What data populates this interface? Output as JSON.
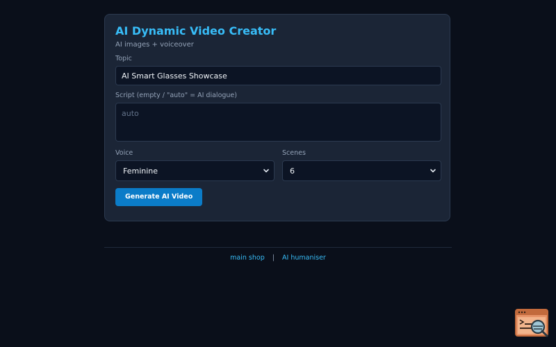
{
  "header": {
    "title": "AI Dynamic Video Creator",
    "subtitle": "AI images + voiceover"
  },
  "form": {
    "topic_label": "Topic",
    "topic_value": "AI Smart Glasses Showcase",
    "script_label": "Script (empty / \"auto\" = AI dialogue)",
    "script_placeholder": "auto",
    "voice_label": "Voice",
    "voice_value": "Feminine",
    "scenes_label": "Scenes",
    "scenes_value": "6",
    "generate_label": "Generate AI Video"
  },
  "footer": {
    "link1": "main shop",
    "separator": "|",
    "link2": "AI humaniser"
  },
  "colors": {
    "accent": "#38bdf8",
    "button": "#0b7cc8",
    "background": "#0a0f1a",
    "card": "#1b2536"
  },
  "icons": {
    "corner": "browser-search-icon",
    "select": "chevron-down-icon"
  }
}
